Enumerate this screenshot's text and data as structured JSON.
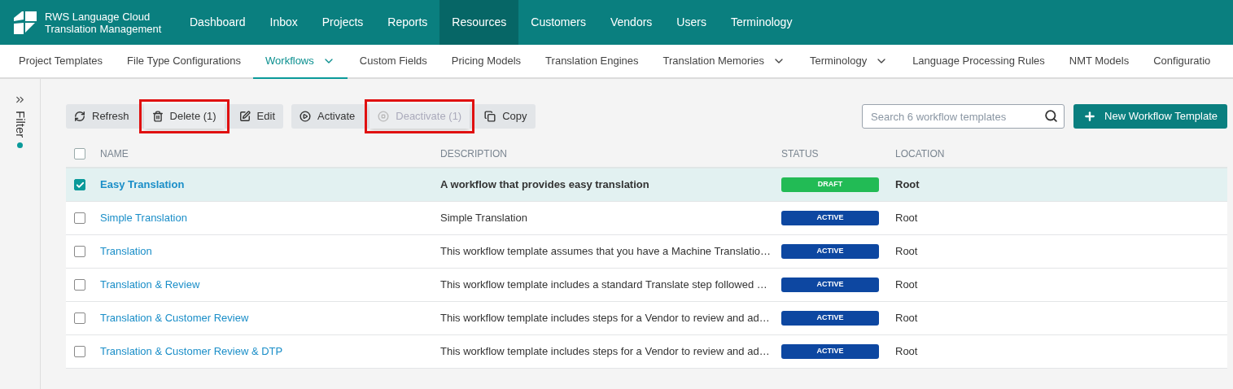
{
  "brand": {
    "line1": "RWS Language Cloud",
    "line2": "Translation Management"
  },
  "top_nav": [
    {
      "label": "Dashboard",
      "selected": false
    },
    {
      "label": "Inbox",
      "selected": false
    },
    {
      "label": "Projects",
      "selected": false
    },
    {
      "label": "Reports",
      "selected": false
    },
    {
      "label": "Resources",
      "selected": true
    },
    {
      "label": "Customers",
      "selected": false
    },
    {
      "label": "Vendors",
      "selected": false
    },
    {
      "label": "Users",
      "selected": false
    },
    {
      "label": "Terminology",
      "selected": false
    }
  ],
  "sub_nav": [
    {
      "label": "Project Templates",
      "selected": false,
      "dropdown": false
    },
    {
      "label": "File Type Configurations",
      "selected": false,
      "dropdown": false
    },
    {
      "label": "Workflows",
      "selected": true,
      "dropdown": true
    },
    {
      "label": "Custom Fields",
      "selected": false,
      "dropdown": false
    },
    {
      "label": "Pricing Models",
      "selected": false,
      "dropdown": false
    },
    {
      "label": "Translation Engines",
      "selected": false,
      "dropdown": false
    },
    {
      "label": "Translation Memories",
      "selected": false,
      "dropdown": true
    },
    {
      "label": "Terminology",
      "selected": false,
      "dropdown": true
    },
    {
      "label": "Language Processing Rules",
      "selected": false,
      "dropdown": false
    },
    {
      "label": "NMT Models",
      "selected": false,
      "dropdown": false
    },
    {
      "label": "Configuratio",
      "selected": false,
      "dropdown": false
    }
  ],
  "filter_panel": {
    "label": "Filter",
    "active": true
  },
  "toolbar": [
    {
      "group": [
        {
          "kind": "refresh",
          "label": "Refresh",
          "disabled": false,
          "highlighted": false
        },
        {
          "kind": "delete",
          "label": "Delete (1)",
          "disabled": false,
          "highlighted": true
        },
        {
          "kind": "edit",
          "label": "Edit",
          "disabled": false,
          "highlighted": false
        }
      ]
    },
    {
      "group": [
        {
          "kind": "activate",
          "label": "Activate",
          "disabled": false,
          "highlighted": false
        },
        {
          "kind": "deactivate",
          "label": "Deactivate (1)",
          "disabled": true,
          "highlighted": true
        },
        {
          "kind": "copy",
          "label": "Copy",
          "disabled": false,
          "highlighted": false
        }
      ]
    }
  ],
  "search": {
    "placeholder": "Search 6 workflow templates"
  },
  "new_button": {
    "label": "New Workflow Template"
  },
  "table": {
    "select_all": {
      "checked": false
    },
    "columns": [
      "NAME",
      "DESCRIPTION",
      "STATUS",
      "LOCATION"
    ],
    "rows": [
      {
        "checked": true,
        "name": "Easy Translation",
        "description": "A workflow that provides easy translation",
        "status": {
          "label": "DRAFT",
          "color": "#22bb55"
        },
        "location": "Root"
      },
      {
        "checked": false,
        "name": "Simple Translation",
        "description": "Simple Translation",
        "status": {
          "label": "ACTIVE",
          "color": "#0d47a1"
        },
        "location": "Root"
      },
      {
        "checked": false,
        "name": "Translation",
        "description": "This workflow template assumes that you have a Machine Translatio…",
        "status": {
          "label": "ACTIVE",
          "color": "#0d47a1"
        },
        "location": "Root"
      },
      {
        "checked": false,
        "name": "Translation & Review",
        "description": "This workflow template includes a standard Translate step followed …",
        "status": {
          "label": "ACTIVE",
          "color": "#0d47a1"
        },
        "location": "Root"
      },
      {
        "checked": false,
        "name": "Translation & Customer Review",
        "description": "This workflow template includes steps for a Vendor to review and ad…",
        "status": {
          "label": "ACTIVE",
          "color": "#0d47a1"
        },
        "location": "Root"
      },
      {
        "checked": false,
        "name": "Translation & Customer Review & DTP",
        "description": "This workflow template includes steps for a Vendor to review and ad…",
        "status": {
          "label": "ACTIVE",
          "color": "#0d47a1"
        },
        "location": "Root"
      }
    ]
  }
}
